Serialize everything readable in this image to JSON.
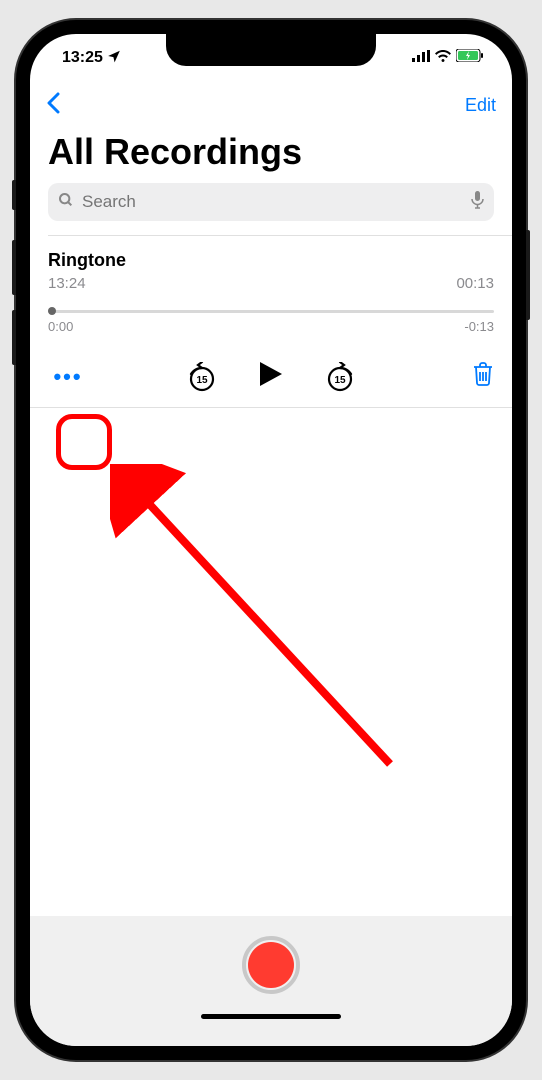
{
  "status_bar": {
    "time": "13:25",
    "location_active": true
  },
  "nav": {
    "edit_label": "Edit"
  },
  "page": {
    "title": "All Recordings"
  },
  "search": {
    "placeholder": "Search"
  },
  "recording": {
    "title": "Ringtone",
    "time_recorded": "13:24",
    "duration": "00:13",
    "scrubber_current": "0:00",
    "scrubber_remaining": "-0:13",
    "skip_back_seconds": "15",
    "skip_forward_seconds": "15"
  },
  "icons": {
    "more": "•••"
  }
}
